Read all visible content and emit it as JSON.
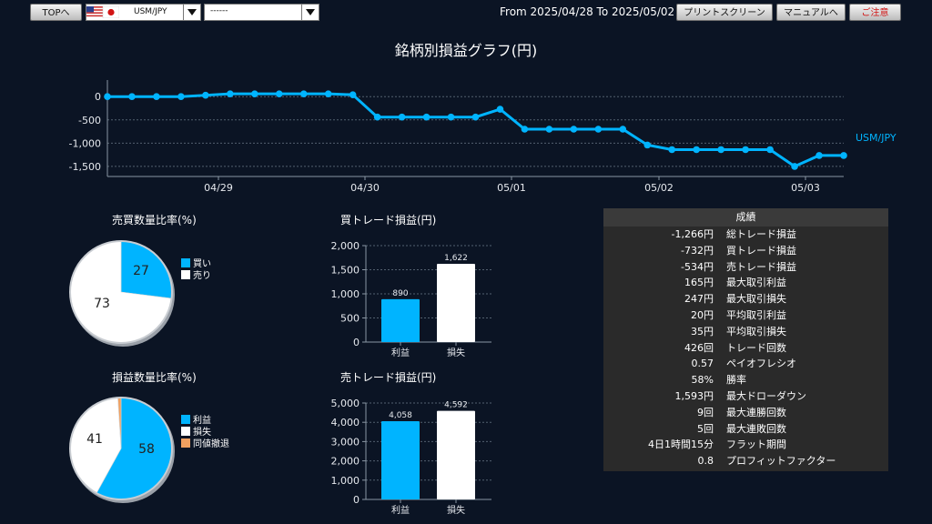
{
  "toolbar": {
    "top_label": "TOPへ",
    "pair_label": "USM/JPY",
    "second_select_value": "------",
    "date_range": "From 2025/04/28 To 2025/05/02",
    "print_label": "プリントスクリーン",
    "manual_label": "マニュアルへ",
    "close_label": "ご注意"
  },
  "main_chart": {
    "title": "銘柄別損益グラフ(円)",
    "series_label": "USM/JPY",
    "series_color": "#00b4ff",
    "chart_data": {
      "type": "line",
      "y_ticks": [
        "0",
        "-500",
        "-1,000",
        "-1,500"
      ],
      "x_ticks": [
        "04/29",
        "04/30",
        "05/01",
        "05/02",
        "05/03"
      ],
      "ylim": [
        -1600,
        200
      ],
      "values": [
        0,
        0,
        0,
        0,
        30,
        60,
        60,
        60,
        60,
        60,
        40,
        -440,
        -440,
        -440,
        -440,
        -440,
        -270,
        -700,
        -700,
        -700,
        -700,
        -700,
        -1040,
        -1140,
        -1140,
        -1140,
        -1140,
        -1140,
        -1500,
        -1266,
        -1266
      ]
    }
  },
  "buy_sell_pie": {
    "title": "売買数量比率(%)",
    "chart_data": {
      "type": "pie",
      "slices": [
        {
          "label": "買い",
          "value": 27,
          "color": "#00b4ff"
        },
        {
          "label": "売り",
          "value": 73,
          "color": "#ffffff"
        }
      ]
    }
  },
  "pl_pie": {
    "title": "損益数量比率(%)",
    "chart_data": {
      "type": "pie",
      "slices": [
        {
          "label": "利益",
          "value": 58,
          "color": "#00b4ff"
        },
        {
          "label": "損失",
          "value": 41,
          "color": "#ffffff"
        },
        {
          "label": "同値撤退",
          "value": 1,
          "color": "#f0a060"
        }
      ]
    }
  },
  "buy_trade_bar": {
    "title": "買トレード損益(円)",
    "chart_data": {
      "type": "bar",
      "categories": [
        "利益",
        "損失"
      ],
      "values": [
        890,
        1622
      ],
      "value_labels": [
        "890",
        "1,622"
      ],
      "y_ticks": [
        "2,000",
        "1,500",
        "1,000",
        "500",
        "0"
      ],
      "ylim": [
        0,
        2000
      ]
    }
  },
  "sell_trade_bar": {
    "title": "売トレード損益(円)",
    "chart_data": {
      "type": "bar",
      "categories": [
        "利益",
        "損失"
      ],
      "values": [
        4058,
        4592
      ],
      "value_labels": [
        "4,058",
        "4,592"
      ],
      "y_ticks": [
        "5,000",
        "4,000",
        "3,000",
        "2,000",
        "1,000",
        "0"
      ],
      "ylim": [
        0,
        5000
      ]
    }
  },
  "stats": {
    "header": "成績",
    "rows": [
      {
        "value": "-1,266円",
        "label": "総トレード損益"
      },
      {
        "value": "-732円",
        "label": "買トレード損益"
      },
      {
        "value": "-534円",
        "label": "売トレード損益"
      },
      {
        "value": "165円",
        "label": "最大取引利益"
      },
      {
        "value": "247円",
        "label": "最大取引損失"
      },
      {
        "value": "20円",
        "label": "平均取引利益"
      },
      {
        "value": "35円",
        "label": "平均取引損失"
      },
      {
        "value": "426回",
        "label": "トレード回数"
      },
      {
        "value": "0.57",
        "label": "ペイオフレシオ"
      },
      {
        "value": "58%",
        "label": "勝率"
      },
      {
        "value": "1,593円",
        "label": "最大ドローダウン"
      },
      {
        "value": "9回",
        "label": "最大連勝回数"
      },
      {
        "value": "5回",
        "label": "最大連敗回数"
      },
      {
        "value": "4日1時間15分",
        "label": "フラット期間"
      },
      {
        "value": "0.8",
        "label": "プロフィットファクター"
      }
    ]
  }
}
